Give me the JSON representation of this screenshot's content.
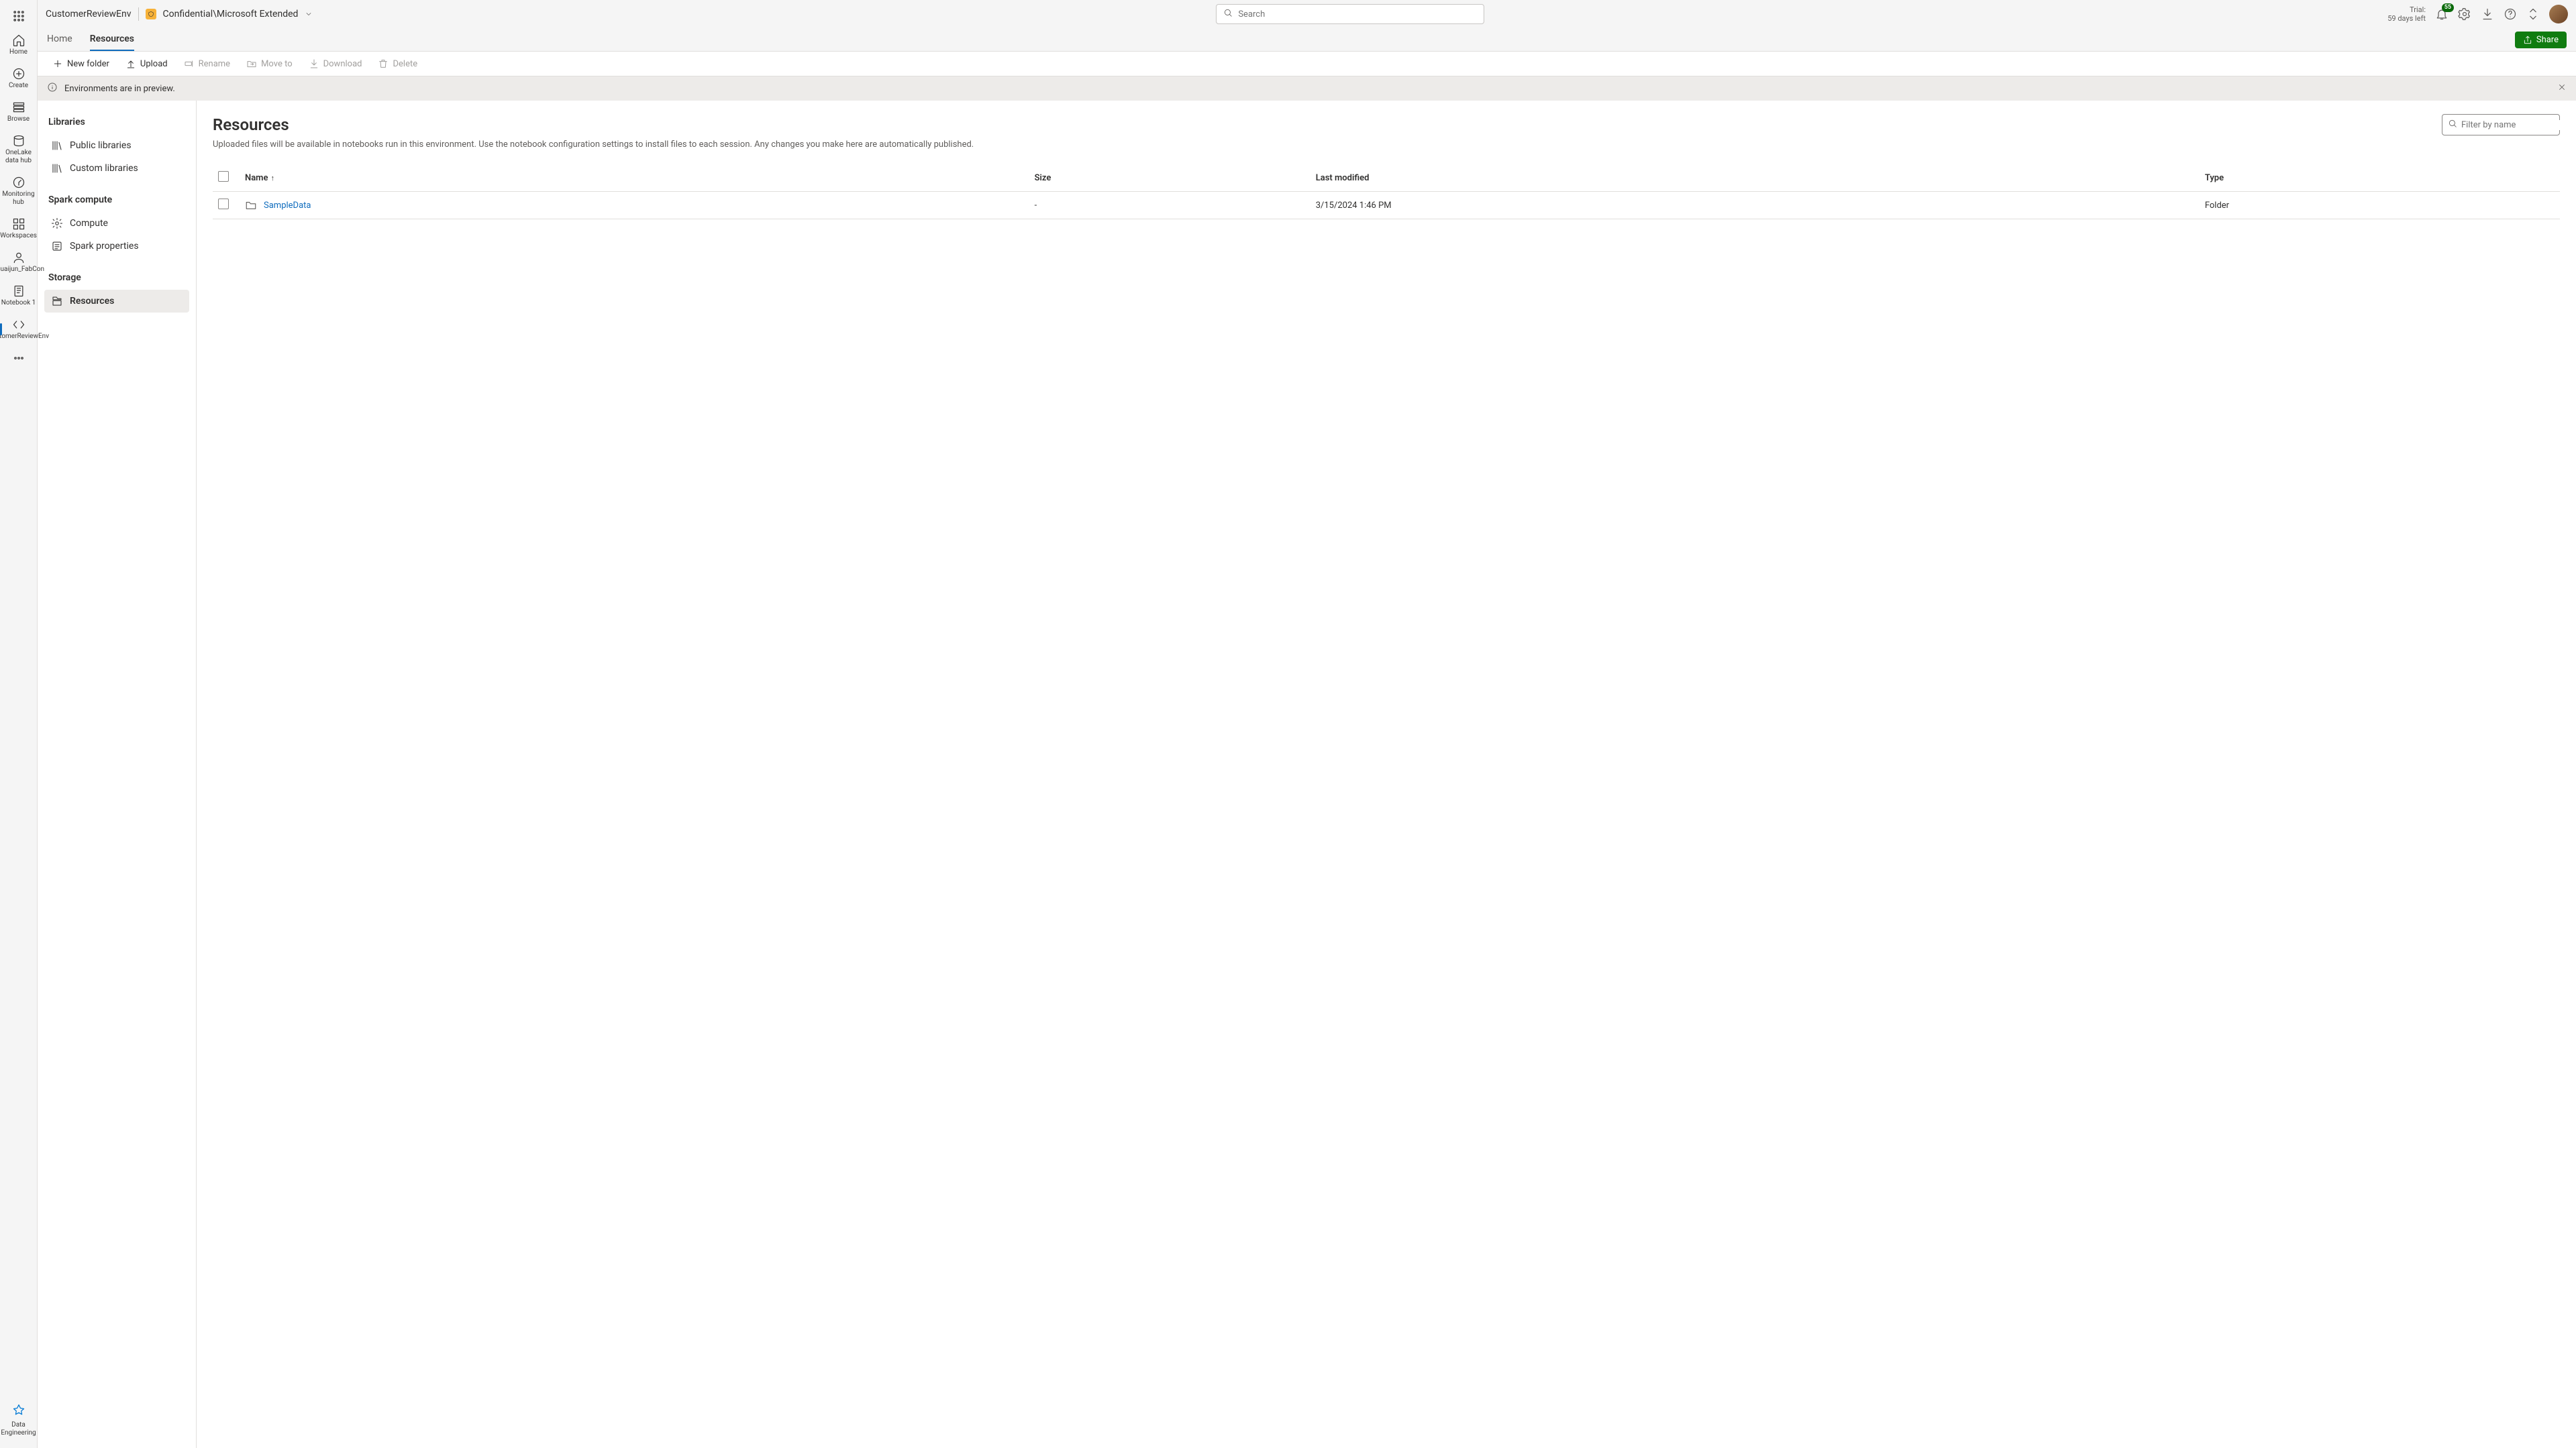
{
  "header": {
    "env_name": "CustomerReviewEnv",
    "sensitivity_label": "Confidential\\Microsoft Extended",
    "search_placeholder": "Search",
    "trial_line1": "Trial:",
    "trial_line2": "59 days left",
    "notif_count": "55"
  },
  "tabs": {
    "home": "Home",
    "resources": "Resources",
    "share": "Share"
  },
  "toolbar": {
    "new_folder": "New folder",
    "upload": "Upload",
    "rename": "Rename",
    "move_to": "Move to",
    "download": "Download",
    "delete": "Delete"
  },
  "banner": {
    "text": "Environments are in preview."
  },
  "rail": {
    "home": "Home",
    "create": "Create",
    "browse": "Browse",
    "onelake": "OneLake data hub",
    "monitoring": "Monitoring hub",
    "workspaces": "Workspaces",
    "shuaijun": "Shuaijun_FabCon",
    "notebook1": "Notebook 1",
    "customerreview": "CustomerReviewEnv",
    "more": "",
    "footer": "Data Engineering"
  },
  "sidepanel": {
    "libraries_header": "Libraries",
    "public_libraries": "Public libraries",
    "custom_libraries": "Custom libraries",
    "spark_header": "Spark compute",
    "compute": "Compute",
    "spark_properties": "Spark properties",
    "storage_header": "Storage",
    "resources": "Resources"
  },
  "content": {
    "title": "Resources",
    "subtitle": "Uploaded files will be available in notebooks run in this environment. Use the notebook configuration settings to install files to each session. Any changes you make here are automatically published.",
    "filter_placeholder": "Filter by name",
    "columns": {
      "name": "Name",
      "size": "Size",
      "modified": "Last modified",
      "type": "Type"
    },
    "rows": [
      {
        "name": "SampleData",
        "size": "-",
        "modified": "3/15/2024 1:46 PM",
        "type": "Folder"
      }
    ]
  }
}
